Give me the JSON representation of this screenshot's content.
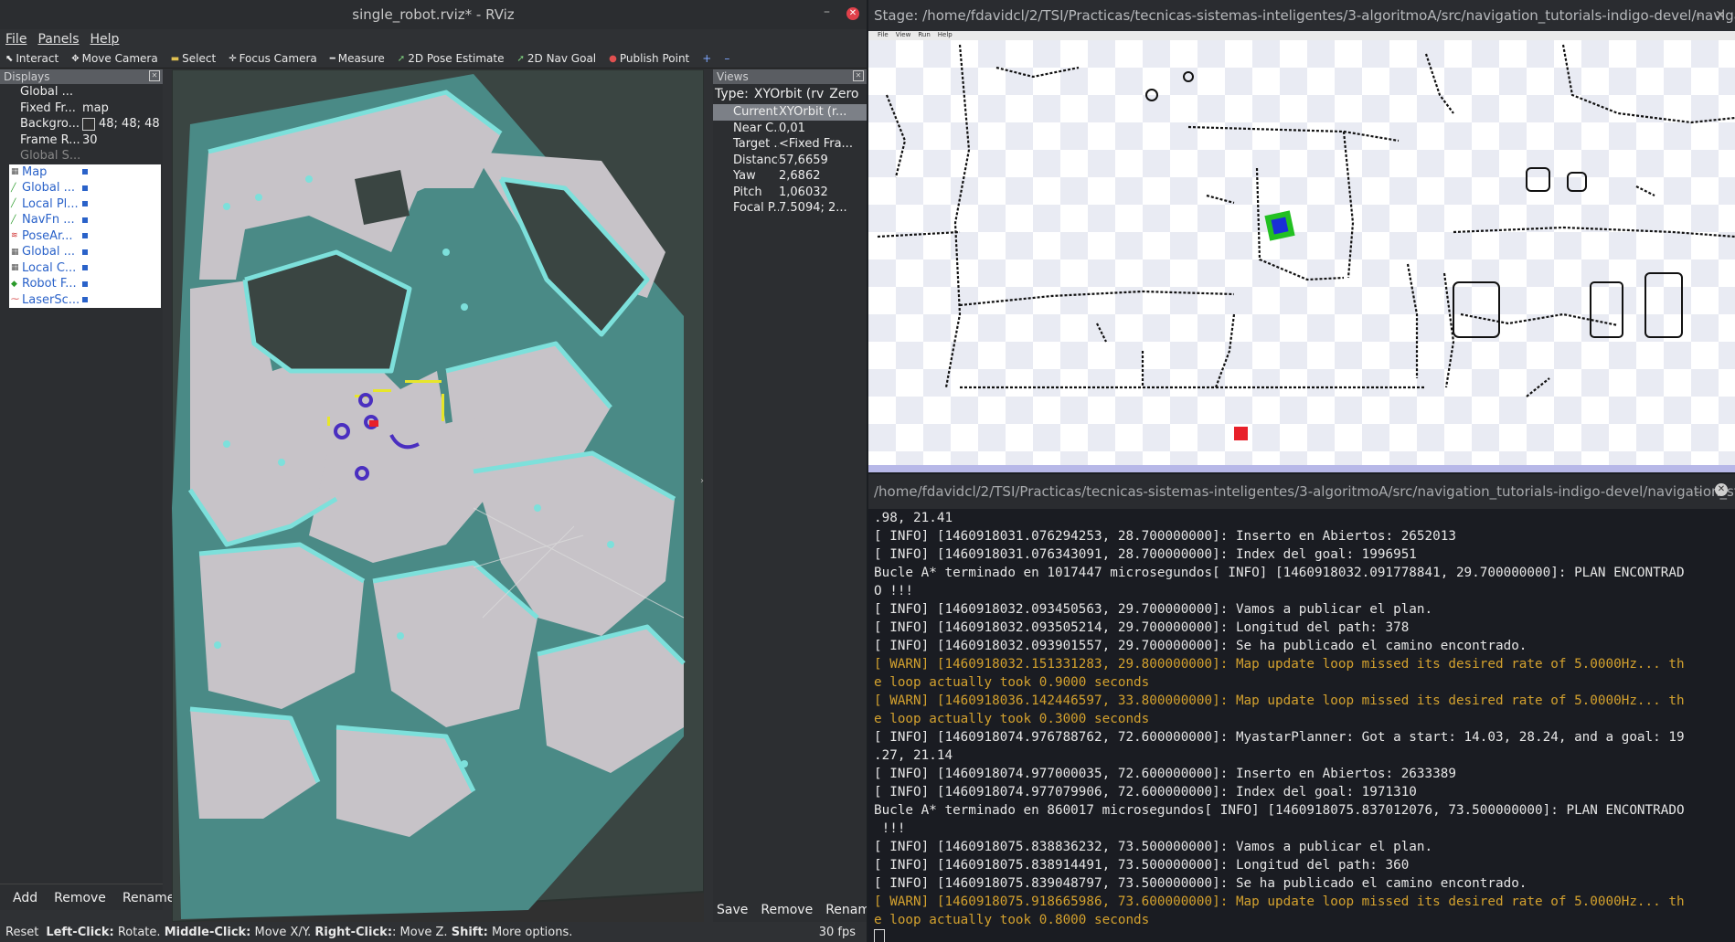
{
  "rviz": {
    "title": "single_robot.rviz* - RViz",
    "menu": [
      "File",
      "Panels",
      "Help"
    ],
    "toolbar": [
      "Interact",
      "Move Camera",
      "Select",
      "Focus Camera",
      "Measure",
      "2D Pose Estimate",
      "2D Nav Goal",
      "Publish Point"
    ],
    "displays_title": "Displays",
    "global_options": [
      {
        "k": "Global ...",
        "v": ""
      },
      {
        "k": "Fixed Fr...",
        "v": "map"
      },
      {
        "k": "Backgro...",
        "v": "48; 48; 48"
      },
      {
        "k": "Frame R...",
        "v": "30"
      },
      {
        "k": "Global S...",
        "v": ""
      }
    ],
    "display_items": [
      "Map",
      "Global ...",
      "Local Pl...",
      "NavFn ...",
      "PoseAr...",
      "Global ...",
      "Local C...",
      "Robot F...",
      "LaserSc..."
    ],
    "displays_buttons": [
      "Add",
      "Remove",
      "Rename"
    ],
    "views_title": "Views",
    "views_type_label": "Type:",
    "views_type_value": "XYOrbit (rv",
    "views_zero": "Zero",
    "views_rows": [
      {
        "k": "Current ...",
        "v": "XYOrbit (r..."
      },
      {
        "k": "Near C...",
        "v": "0,01"
      },
      {
        "k": "Target ...",
        "v": "<Fixed Fra..."
      },
      {
        "k": "Distance",
        "v": "57,6659"
      },
      {
        "k": "Yaw",
        "v": "2,6862"
      },
      {
        "k": "Pitch",
        "v": "1,06032"
      },
      {
        "k": "Focal P...",
        "v": "7.5094; 2..."
      }
    ],
    "views_buttons": [
      "Save",
      "Remove",
      "Rename"
    ],
    "status": {
      "reset": "Reset",
      "left": "Left-Click:",
      "left_t": "Rotate.",
      "middle": "Middle-Click:",
      "middle_t": "Move X/Y.",
      "right": "Right-Click:",
      "right_t": ": Move Z.",
      "shift": "Shift:",
      "shift_t": "More options.",
      "fps": "30 fps"
    }
  },
  "stage": {
    "title": "Stage: /home/fdavidcl/2/TSI/Practicas/tecnicas-sistemas-inteligentes/3-algoritmoA/src/navigation_tutorials-indigo-devel/navigati...",
    "menu": [
      "File",
      "View",
      "Run",
      "Help"
    ]
  },
  "terminal": {
    "title": "/home/fdavidcl/2/TSI/Practicas/tecnicas-sistemas-inteligentes/3-algoritmoA/src/navigation_tutorials-indigo-devel/navigation_stag...",
    "lines": [
      {
        "t": ".98, 21.41",
        "warn": false
      },
      {
        "t": "[ INFO] [1460918031.076294253, 28.700000000]: Inserto en Abiertos: 2652013",
        "warn": false
      },
      {
        "t": "[ INFO] [1460918031.076343091, 28.700000000]: Index del goal: 1996951",
        "warn": false
      },
      {
        "t": "Bucle A* terminado en 1017447 microsegundos[ INFO] [1460918032.091778841, 29.700000000]: PLAN ENCONTRAD",
        "warn": false
      },
      {
        "t": "O !!!",
        "warn": false
      },
      {
        "t": "[ INFO] [1460918032.093450563, 29.700000000]: Vamos a publicar el plan.",
        "warn": false
      },
      {
        "t": "[ INFO] [1460918032.093505214, 29.700000000]: Longitud del path: 378",
        "warn": false
      },
      {
        "t": "[ INFO] [1460918032.093901557, 29.700000000]: Se ha publicado el camino encontrado.",
        "warn": false
      },
      {
        "t": "[ WARN] [1460918032.151331283, 29.800000000]: Map update loop missed its desired rate of 5.0000Hz... th",
        "warn": true
      },
      {
        "t": "e loop actually took 0.9000 seconds",
        "warn": true
      },
      {
        "t": "[ WARN] [1460918036.142446597, 33.800000000]: Map update loop missed its desired rate of 5.0000Hz... th",
        "warn": true
      },
      {
        "t": "e loop actually took 0.3000 seconds",
        "warn": true
      },
      {
        "t": "[ INFO] [1460918074.976788762, 72.600000000]: MyastarPlanner: Got a start: 14.03, 28.24, and a goal: 19",
        "warn": false
      },
      {
        "t": ".27, 21.14",
        "warn": false
      },
      {
        "t": "[ INFO] [1460918074.977000035, 72.600000000]: Inserto en Abiertos: 2633389",
        "warn": false
      },
      {
        "t": "[ INFO] [1460918074.977079906, 72.600000000]: Index del goal: 1971310",
        "warn": false
      },
      {
        "t": "Bucle A* terminado en 860017 microsegundos[ INFO] [1460918075.837012076, 73.500000000]: PLAN ENCONTRADO",
        "warn": false
      },
      {
        "t": " !!!",
        "warn": false
      },
      {
        "t": "[ INFO] [1460918075.838836232, 73.500000000]: Vamos a publicar el plan.",
        "warn": false
      },
      {
        "t": "[ INFO] [1460918075.838914491, 73.500000000]: Longitud del path: 360",
        "warn": false
      },
      {
        "t": "[ INFO] [1460918075.839048797, 73.500000000]: Se ha publicado el camino encontrado.",
        "warn": false
      },
      {
        "t": "[ WARN] [1460918075.918665986, 73.600000000]: Map update loop missed its desired rate of 5.0000Hz... th",
        "warn": true
      },
      {
        "t": "e loop actually took 0.8000 seconds",
        "warn": true
      }
    ]
  },
  "colors": {
    "warn": "#d3a12e",
    "map_free": "#c7c3c8",
    "map_inflation": "#4a8a86",
    "map_cost": "#7de0db",
    "robot_goal": "#e8202a",
    "stage_robot_border": "#22c022",
    "stage_robot": "#1a2fd8"
  }
}
